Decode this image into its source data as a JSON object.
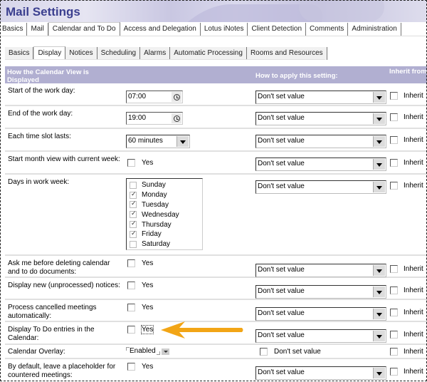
{
  "app": {
    "title": "Mail Settings"
  },
  "main_tabs": [
    {
      "label": "Basics",
      "active": false
    },
    {
      "label": "Mail",
      "active": false
    },
    {
      "label": "Calendar and To Do",
      "active": true
    },
    {
      "label": "Access and Delegation",
      "active": false
    },
    {
      "label": "Lotus iNotes",
      "active": false
    },
    {
      "label": "Client Detection",
      "active": false
    },
    {
      "label": "Comments",
      "active": false
    },
    {
      "label": "Administration",
      "active": false
    }
  ],
  "sub_tabs": [
    {
      "label": "Basics",
      "active": false
    },
    {
      "label": "Display",
      "active": true
    },
    {
      "label": "Notices",
      "active": false
    },
    {
      "label": "Scheduling",
      "active": false
    },
    {
      "label": "Alarms",
      "active": false
    },
    {
      "label": "Automatic Processing",
      "active": false
    },
    {
      "label": "Rooms and Resources",
      "active": false
    }
  ],
  "table": {
    "headers": {
      "section": "How the Calendar View is Displayed",
      "apply": "How to apply this setting:",
      "inherit": "Inherit from parent policy"
    },
    "apply_default": "Don't set value",
    "inherit_label": "Inherit",
    "yes_label": "Yes",
    "rows": {
      "start_day": {
        "label": "Start of the work day:",
        "value": "07:00"
      },
      "end_day": {
        "label": "End of the work day:",
        "value": "19:00"
      },
      "time_slot": {
        "label": "Each time slot lasts:",
        "value": "60 minutes"
      },
      "month_view": {
        "label": "Start month view with current week:",
        "checked": false
      },
      "work_week": {
        "label": "Days in work week:",
        "days": [
          {
            "name": "Sunday",
            "checked": false
          },
          {
            "name": "Monday",
            "checked": true
          },
          {
            "name": "Tuesday",
            "checked": true
          },
          {
            "name": "Wednesday",
            "checked": true
          },
          {
            "name": "Thursday",
            "checked": true
          },
          {
            "name": "Friday",
            "checked": true
          },
          {
            "name": "Saturday",
            "checked": false
          }
        ]
      },
      "ask_delete": {
        "label": "Ask me before deleting calendar and to do documents:",
        "checked": false
      },
      "new_notices": {
        "label": "Display new (unprocessed) notices:",
        "checked": false
      },
      "process_cancelled": {
        "label": "Process cancelled meetings automatically:",
        "checked": false
      },
      "todo_in_calendar": {
        "label": "Display To Do entries in the Calendar:",
        "checked": false
      },
      "calendar_overlay": {
        "label": "Calendar Overlay:",
        "value": "Enabled",
        "apply_checkbox_label": "Don't set value"
      },
      "placeholder": {
        "label": "By default, leave a placeholder for countered meetings:",
        "checked": false
      }
    }
  },
  "annotation": {
    "arrow_color": "#f2a516"
  },
  "colors": {
    "header_bg": "#b1afd1",
    "title": "#3b3f8f"
  }
}
